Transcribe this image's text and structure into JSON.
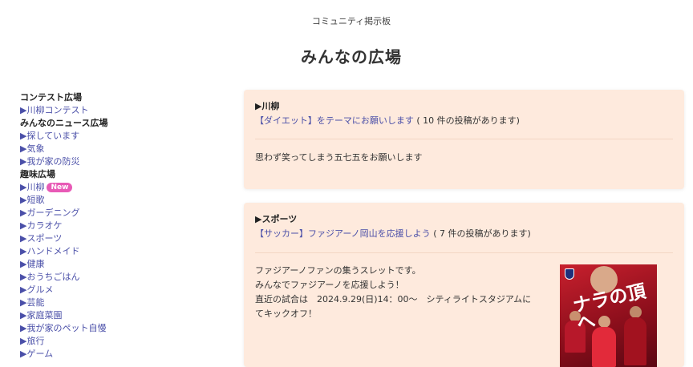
{
  "header": {
    "site_name": "コミュニティ掲示板",
    "page_title": "みんなの広場"
  },
  "sidebar": {
    "sections": [
      {
        "title": "コンテスト広場",
        "items": [
          {
            "label": "▶川柳コンテスト"
          }
        ]
      },
      {
        "title": "みんなのニュース広場",
        "items": [
          {
            "label": "▶探しています"
          },
          {
            "label": "▶気象"
          },
          {
            "label": "▶我が家の防災"
          }
        ]
      },
      {
        "title": "趣味広場",
        "items": [
          {
            "label": "▶川柳",
            "badge": "New"
          },
          {
            "label": "▶短歌"
          },
          {
            "label": "▶ガーデニング"
          },
          {
            "label": "▶カラオケ"
          },
          {
            "label": "▶スポーツ"
          },
          {
            "label": "▶ハンドメイド"
          },
          {
            "label": "▶健康"
          },
          {
            "label": "▶おうちごはん"
          },
          {
            "label": "▶グルメ"
          },
          {
            "label": "▶芸能"
          },
          {
            "label": "▶家庭菜園"
          },
          {
            "label": "▶我が家のペット自慢"
          },
          {
            "label": "▶旅行"
          },
          {
            "label": "▶ゲーム"
          }
        ]
      }
    ]
  },
  "cards": [
    {
      "category": "▶川柳",
      "theme_link": "【ダイエット】をテーマにお願いします",
      "post_count": "( 10 件の投稿があります)",
      "body": [
        "思わず笑ってしまう五七五をお願いします"
      ]
    },
    {
      "category": "▶スポーツ",
      "theme_link": "【サッカー】ファジアーノ岡山を応援しよう",
      "post_count": "( 7 件の投稿があります)",
      "body": [
        "ファジアーノファンの集うスレットです。",
        "みんなでファジアーノを応援しよう！",
        "直近の試合は　2024.9.29(日)14：00～　シティライトスタジアムにてキックオフ！"
      ],
      "poster_text": "ナラの頂へ"
    }
  ],
  "colors": {
    "link": "#4a4fa8",
    "card_bg": "#feeadd",
    "badge_bg": "#e85ab6"
  }
}
